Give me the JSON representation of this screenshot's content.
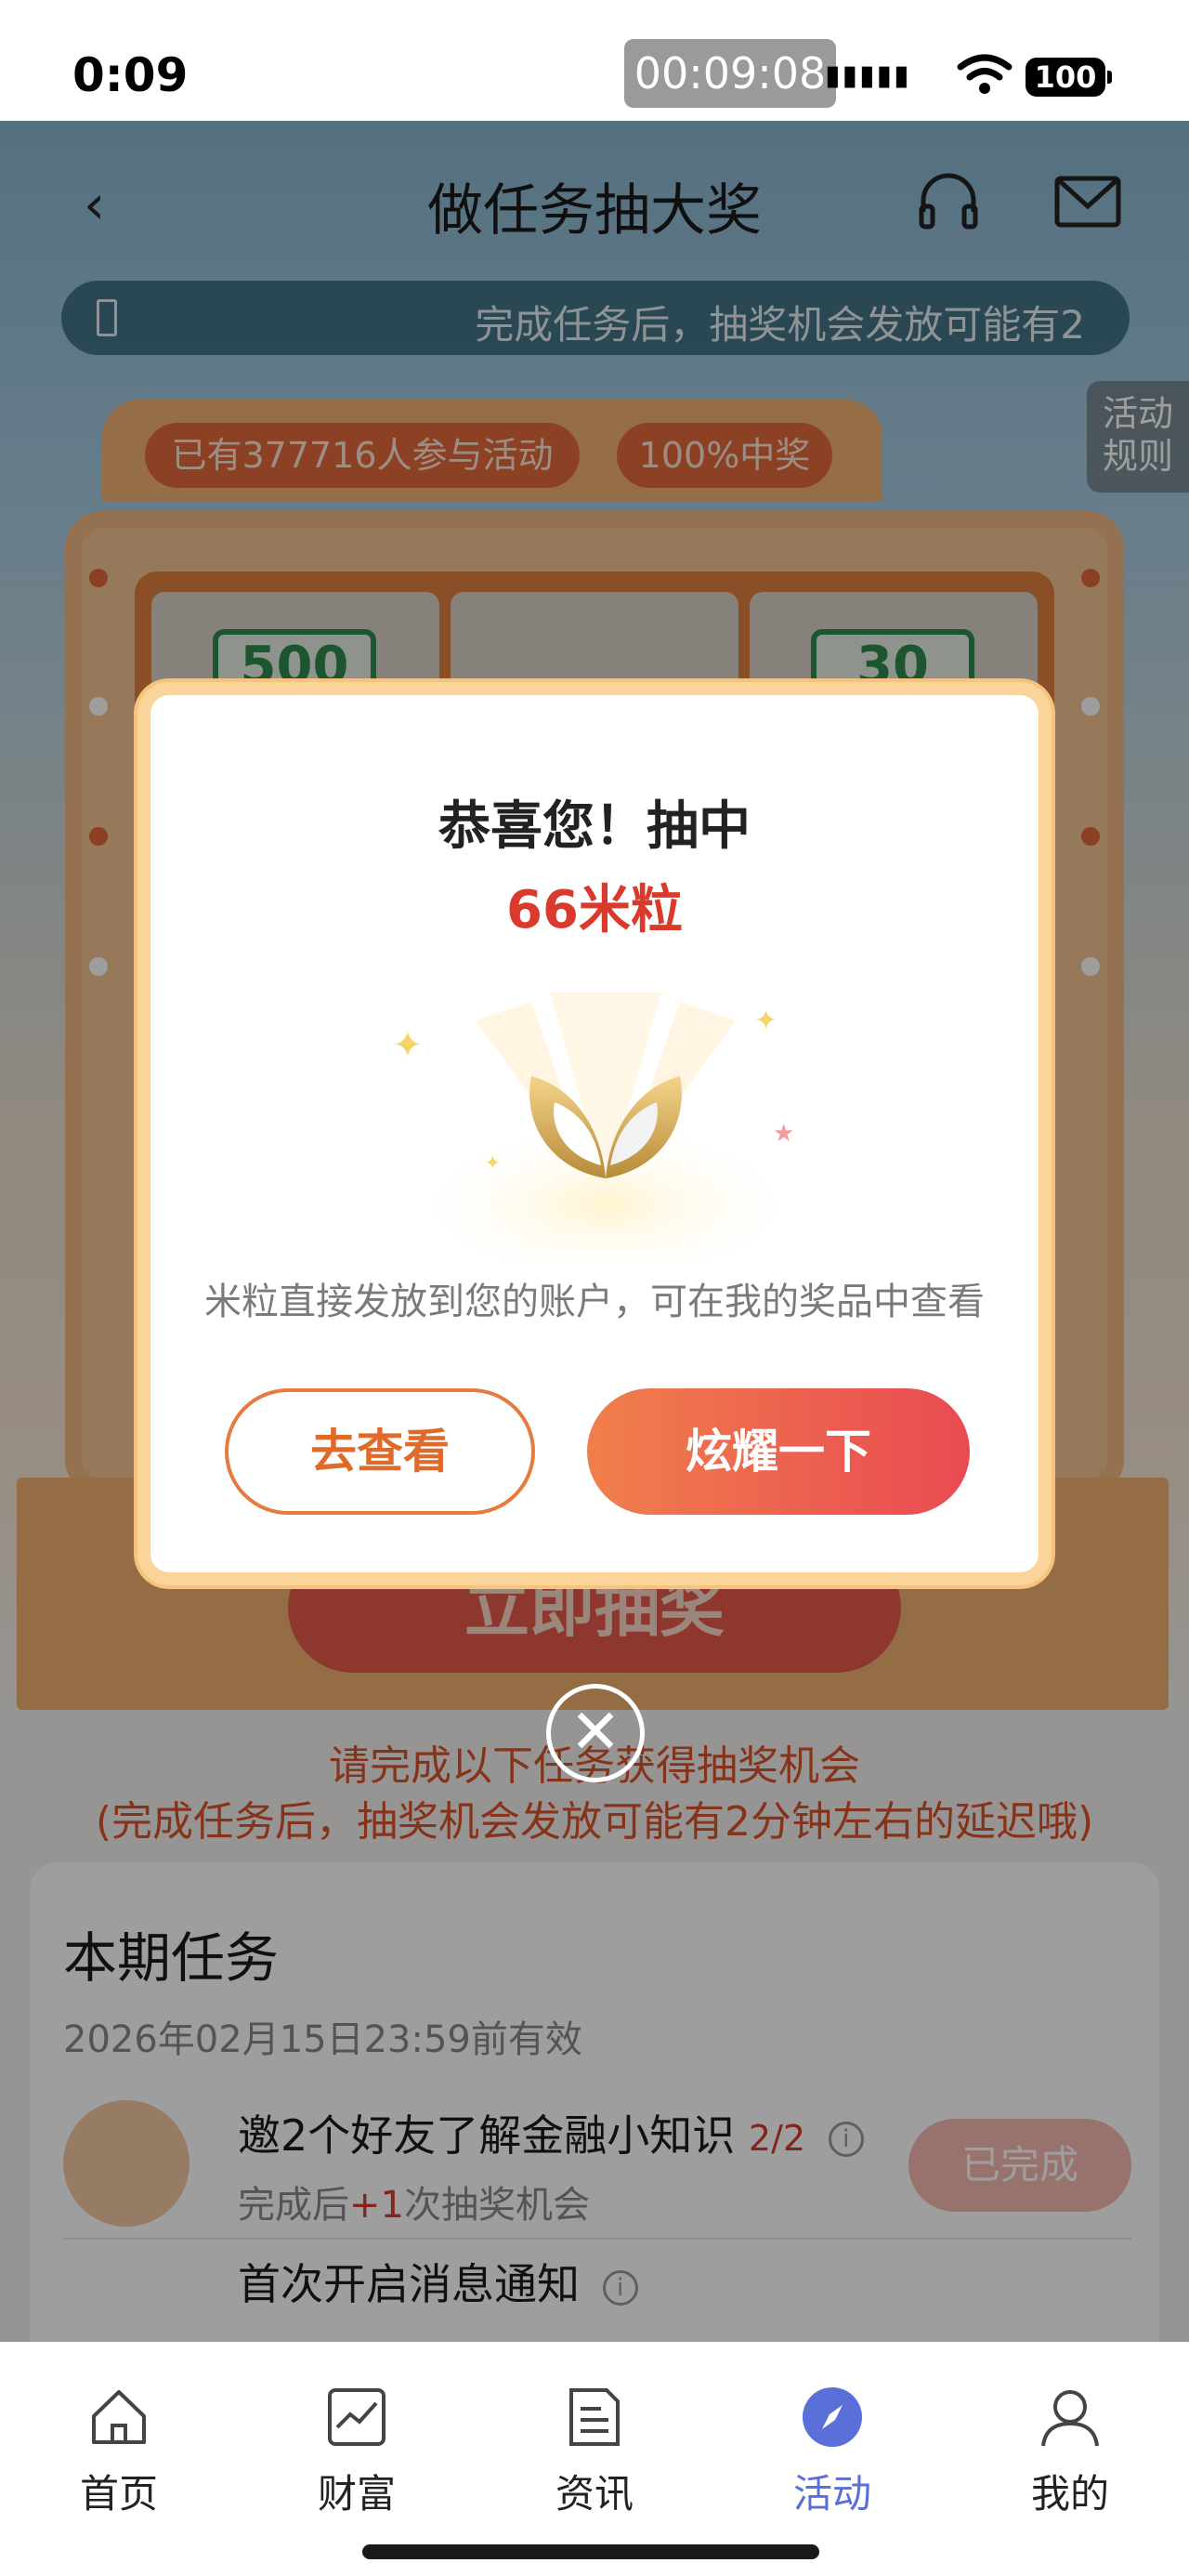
{
  "status_bar": {
    "time": "0:09",
    "recording": "00:09:08",
    "battery": "100"
  },
  "header": {
    "title": "做任务抽大奖"
  },
  "notice": {
    "text": "完成任务后，抽奖机会发放可能有2"
  },
  "rules_tab": {
    "line1": "活动",
    "line2": "规则"
  },
  "machine": {
    "participants": "已有377716人参与活动",
    "win_rate": "100%中奖",
    "reel_left": "500",
    "reel_right": "30",
    "draw_button": "立即抽奖"
  },
  "hint": {
    "line1": "请完成以下任务获得抽奖机会",
    "line2": "(完成任务后，抽奖机会发放可能有2分钟左右的延迟哦)"
  },
  "tasks": {
    "title": "本期任务",
    "valid_until": "2026年02月15日23:59前有效",
    "items": [
      {
        "name": "邀2个好友了解金融小知识",
        "progress": "2/2",
        "sub_prefix": "完成后",
        "sub_plus": "+1",
        "sub_suffix": "次抽奖机会",
        "status": "已完成"
      },
      {
        "name": "首次开启消息通知"
      }
    ]
  },
  "modal": {
    "title": "恭喜您！抽中",
    "prize": "66米粒",
    "description": "米粒直接发放到您的账户，可在我的奖品中查看",
    "view_button": "去查看",
    "share_button": "炫耀一下"
  },
  "tabbar": {
    "items": [
      {
        "label": "首页",
        "icon": "home-icon"
      },
      {
        "label": "财富",
        "icon": "chart-icon"
      },
      {
        "label": "资讯",
        "icon": "news-icon"
      },
      {
        "label": "活动",
        "icon": "compass-icon",
        "active": true
      },
      {
        "label": "我的",
        "icon": "user-icon"
      }
    ]
  },
  "colors": {
    "accent": "#e94a52",
    "tab_active": "#5a6fd8",
    "prize_red": "#d93a2b"
  }
}
